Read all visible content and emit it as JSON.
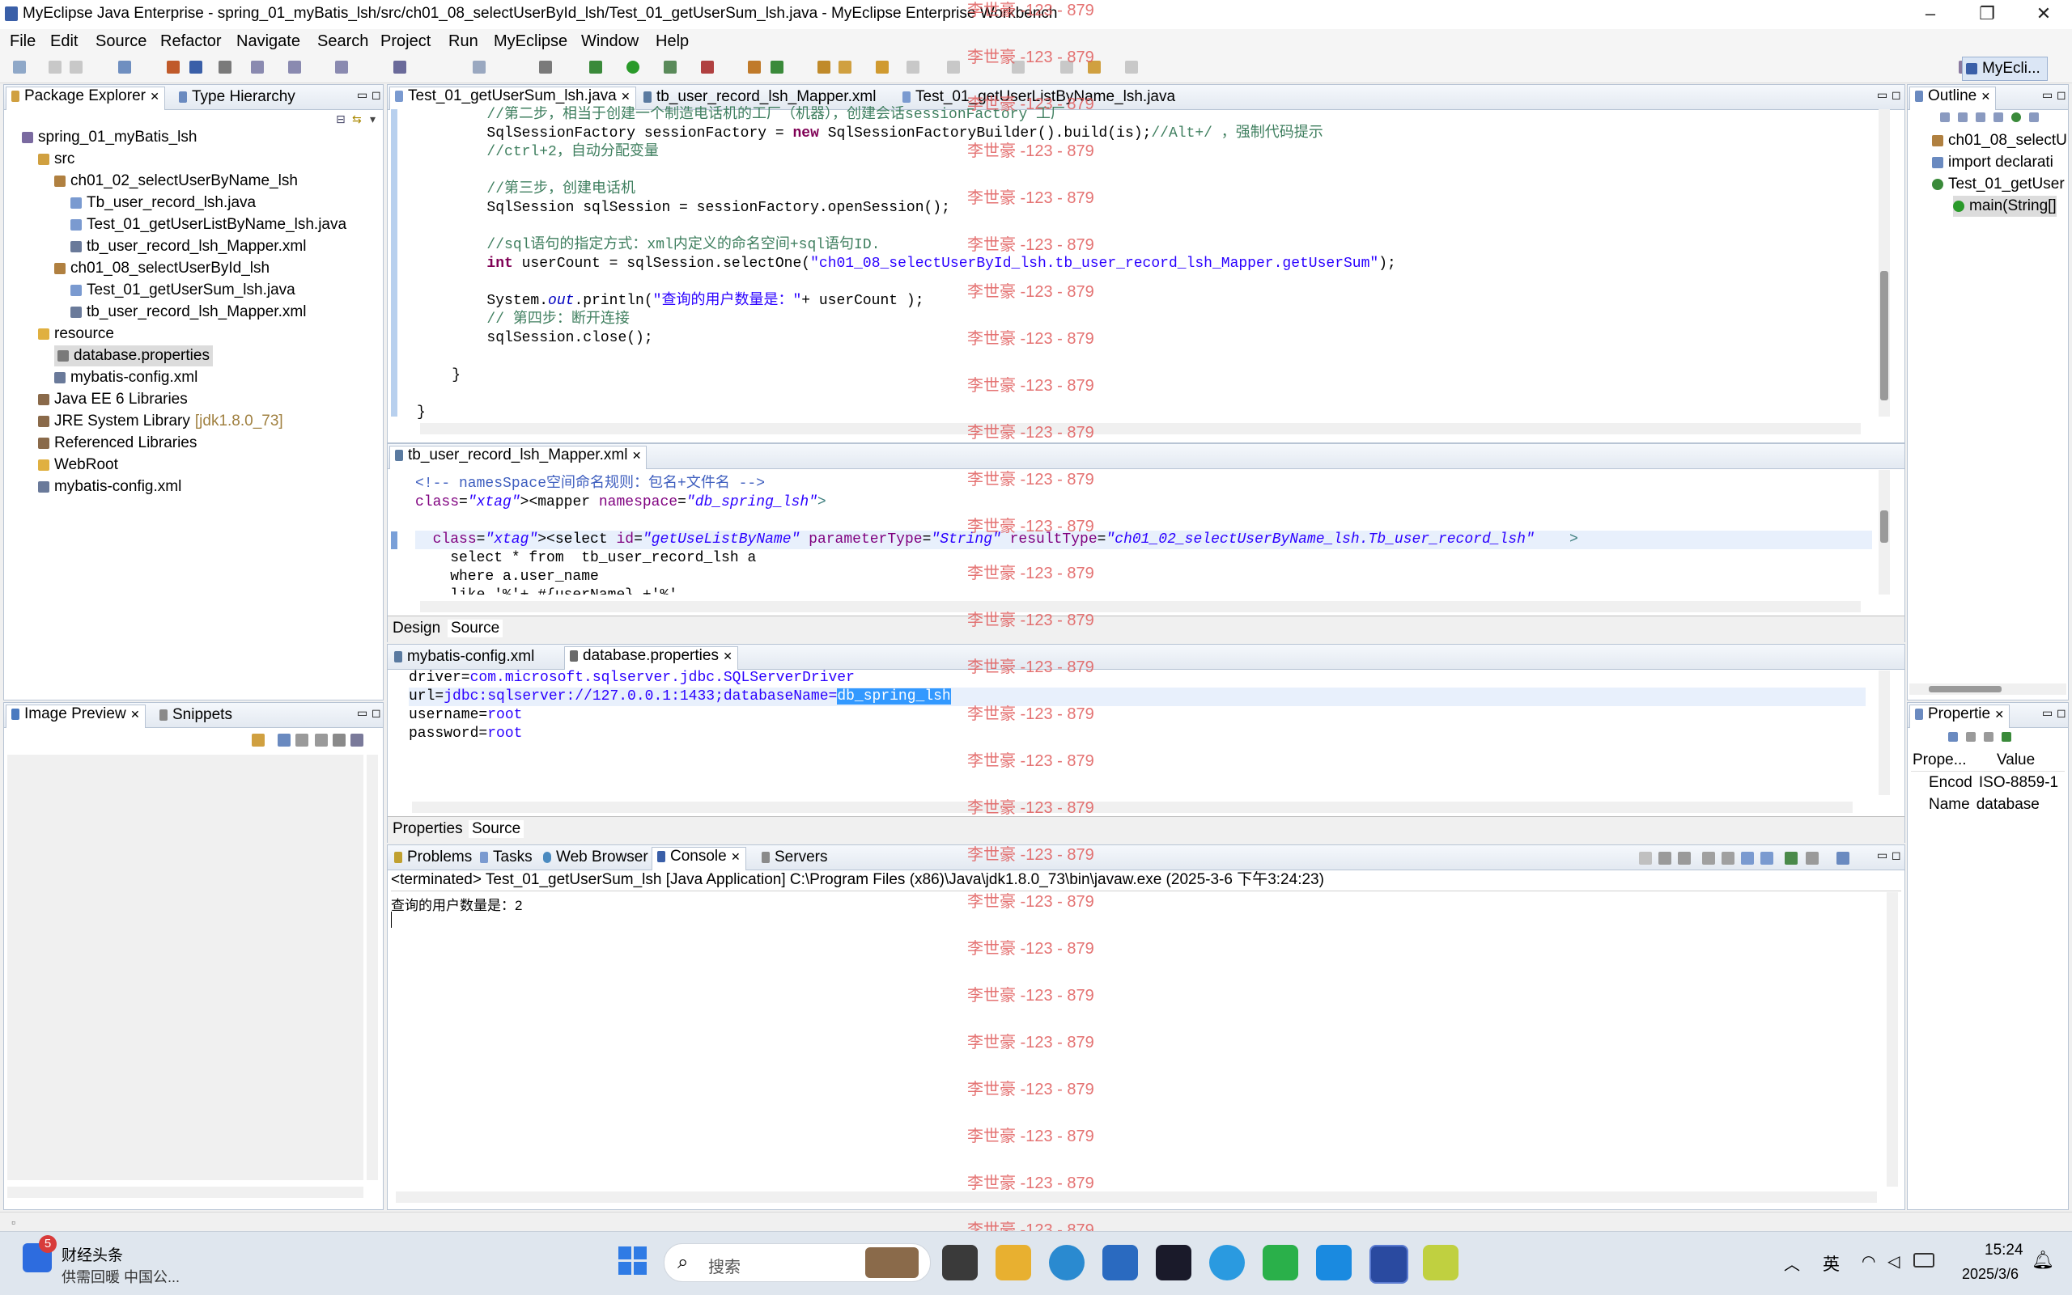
{
  "window": {
    "title": "MyEclipse Java Enterprise - spring_01_myBatis_lsh/src/ch01_08_selectUserById_lsh/Test_01_getUserSum_lsh.java - MyEclipse Enterprise Workbench",
    "minimize": "–",
    "maximize": "❐",
    "close": "✕"
  },
  "menu": [
    "File",
    "Edit",
    "Source",
    "Refactor",
    "Navigate",
    "Search",
    "Project",
    "Run",
    "MyEclipse",
    "Window",
    "Help"
  ],
  "perspective": "MyEcli...",
  "package_explorer": {
    "tabs": [
      "Package Explorer",
      "Type Hierarchy"
    ],
    "tree": [
      {
        "label": "spring_01_myBatis_lsh",
        "indent": 0,
        "icon": "project-icon"
      },
      {
        "label": "src",
        "indent": 1,
        "icon": "source-folder-icon"
      },
      {
        "label": "ch01_02_selectUserByName_lsh",
        "indent": 2,
        "icon": "package-icon"
      },
      {
        "label": "Tb_user_record_lsh.java",
        "indent": 3,
        "icon": "java-file-icon"
      },
      {
        "label": "Test_01_getUserListByName_lsh.java",
        "indent": 3,
        "icon": "java-file-icon"
      },
      {
        "label": "tb_user_record_lsh_Mapper.xml",
        "indent": 3,
        "icon": "xml-file-icon"
      },
      {
        "label": "ch01_08_selectUserById_lsh",
        "indent": 2,
        "icon": "package-icon"
      },
      {
        "label": "Test_01_getUserSum_lsh.java",
        "indent": 3,
        "icon": "java-file-icon"
      },
      {
        "label": "tb_user_record_lsh_Mapper.xml",
        "indent": 3,
        "icon": "xml-file-icon"
      },
      {
        "label": "resource",
        "indent": 1,
        "icon": "folder-icon"
      },
      {
        "label": "database.properties",
        "indent": 2,
        "icon": "properties-file-icon",
        "selected": true
      },
      {
        "label": "mybatis-config.xml",
        "indent": 2,
        "icon": "xml-file-icon"
      },
      {
        "label": "Java EE 6 Libraries",
        "indent": 1,
        "icon": "library-icon"
      },
      {
        "label": "JRE System Library",
        "suffix": "[jdk1.8.0_73]",
        "indent": 1,
        "icon": "library-icon"
      },
      {
        "label": "Referenced Libraries",
        "indent": 1,
        "icon": "library-icon"
      },
      {
        "label": "WebRoot",
        "indent": 1,
        "icon": "folder-icon"
      },
      {
        "label": "mybatis-config.xml",
        "indent": 1,
        "icon": "xml-file-icon"
      }
    ]
  },
  "image_preview": {
    "tabs": [
      "Image Preview",
      "Snippets"
    ]
  },
  "editor_top": {
    "tabs": [
      "Test_01_getUserSum_lsh.java",
      "tb_user_record_lsh_Mapper.xml",
      "Test_01_getUserListByName_lsh.java"
    ],
    "lines": [
      "        //第二步，相当于创建一个制造电话机的工厂（机器），创建会话sessionFactory 工厂",
      "        SqlSessionFactory sessionFactory = new SqlSessionFactoryBuilder().build(is);//Alt+/ ，强制代码提示",
      "        //ctrl+2，自动分配变量",
      "",
      "        //第三步，创建电话机",
      "        SqlSession sqlSession = sessionFactory.openSession();",
      "",
      "        //sql语句的指定方式：xml内定义的命名空间+sql语句ID.",
      "        int userCount = sqlSession.selectOne(\"ch01_08_selectUserById_lsh.tb_user_record_lsh_Mapper.getUserSum\");",
      "",
      "        System.out.println(\"查询的用户数量是：\"+ userCount );",
      "        // 第四步：断开连接",
      "        sqlSession.close();",
      "",
      "    }",
      "",
      "}"
    ]
  },
  "editor_mapper": {
    "tab": "tb_user_record_lsh_Mapper.xml",
    "lines": [
      "<!-- namesSpace空间命名规则：包名+文件名 -->",
      "<mapper namespace=\"db_spring_lsh\">",
      "",
      "  <select id=\"getUseListByName\" parameterType=\"String\" resultType=\"ch01_02_selectUserByName_lsh.Tb_user_record_lsh\"    >",
      "    select * from  tb_user_record_lsh a",
      "    where a.user_name",
      "    like '%'+ #{userName} +'%'"
    ],
    "bottom_tabs": [
      "Design",
      "Source"
    ]
  },
  "editor_props": {
    "tabs": [
      "mybatis-config.xml",
      "database.properties"
    ],
    "lines": [
      {
        "key": "driver=",
        "value": "com.microsoft.sqlserver.jdbc.SQLServerDriver"
      },
      {
        "key": "url=",
        "value": "jdbc:sqlserver://127.0.0.1:1433;databaseName=",
        "selected": "db_spring_lsh"
      },
      {
        "key": "username=",
        "value": "root"
      },
      {
        "key": "password=",
        "value": "root"
      }
    ],
    "bottom_tabs": [
      "Properties",
      "Source"
    ]
  },
  "console": {
    "tabs": [
      "Problems",
      "Tasks",
      "Web Browser",
      "Console",
      "Servers"
    ],
    "header": "<terminated> Test_01_getUserSum_lsh [Java Application] C:\\Program Files (x86)\\Java\\jdk1.8.0_73\\bin\\javaw.exe (2025-3-6 下午3:24:23)",
    "output": "查询的用户数量是：2"
  },
  "outline": {
    "tab": "Outline",
    "items": [
      {
        "label": "ch01_08_selectU",
        "indent": 0
      },
      {
        "label": "import declarati",
        "indent": 0
      },
      {
        "label": "Test_01_getUser",
        "indent": 0
      },
      {
        "label": "main(String[]",
        "indent": 1
      }
    ]
  },
  "properties_view": {
    "tab": "Propertie",
    "header": [
      "Prope...",
      "Value"
    ],
    "rows": [
      [
        "Encod",
        "ISO-8859-1"
      ],
      [
        "Name",
        "database"
      ]
    ]
  },
  "watermark": "李世豪 -123 - 879",
  "taskbar": {
    "news_badge": "5",
    "news_title": "财经头条",
    "news_sub": "供需回暖 中国公...",
    "search_placeholder": "搜索",
    "ime": "英",
    "time": "15:24",
    "date": "2025/3/6"
  }
}
